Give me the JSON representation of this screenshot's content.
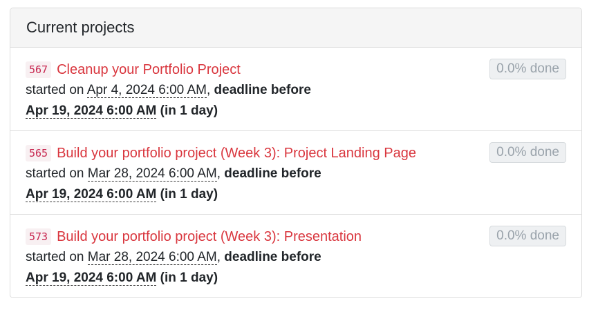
{
  "panel": {
    "title": "Current projects"
  },
  "projects": [
    {
      "id": "567",
      "name": "Cleanup your Portfolio Project",
      "started_prefix": "started on",
      "started_date": "Apr 4, 2024 6:00 AM",
      "deadline_prefix": "deadline before",
      "deadline_date": "Apr 19, 2024 6:00 AM",
      "deadline_relative": "(in 1 day)",
      "progress": "0.0% done"
    },
    {
      "id": "565",
      "name": "Build your portfolio project (Week 3): Project Landing Page",
      "started_prefix": "started on",
      "started_date": "Mar 28, 2024 6:00 AM",
      "deadline_prefix": "deadline before",
      "deadline_date": "Apr 19, 2024 6:00 AM",
      "deadline_relative": "(in 1 day)",
      "progress": "0.0% done"
    },
    {
      "id": "573",
      "name": "Build your portfolio project (Week 3): Presentation",
      "started_prefix": "started on",
      "started_date": "Mar 28, 2024 6:00 AM",
      "deadline_prefix": "deadline before",
      "deadline_date": "Apr 19, 2024 6:00 AM",
      "deadline_relative": "(in 1 day)",
      "progress": "0.0% done"
    }
  ]
}
